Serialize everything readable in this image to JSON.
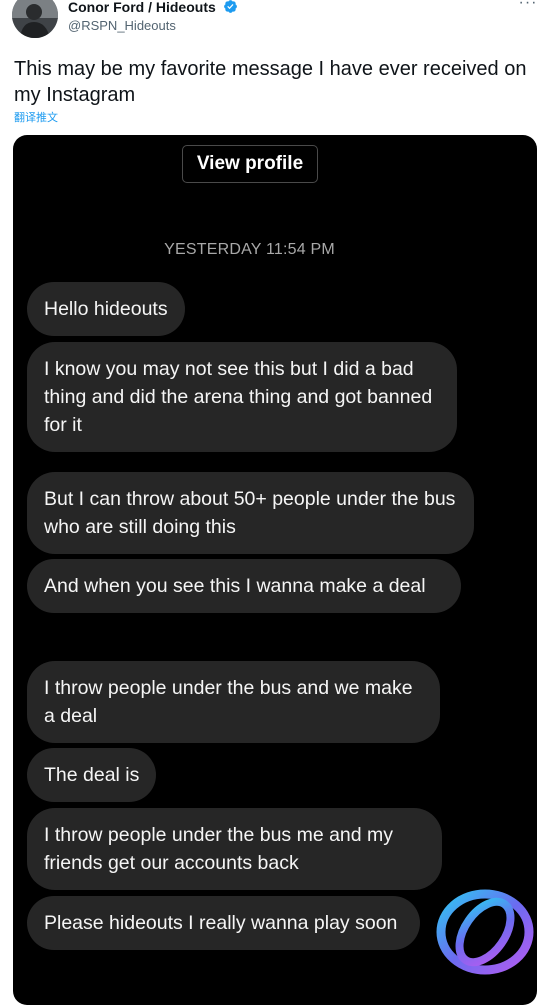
{
  "tweet": {
    "author_name": "Conor Ford / Hideouts",
    "handle": "@RSPN_Hideouts",
    "more_icon": "more-horizontal-icon",
    "text": "This may be my favorite message I have ever received on my Instagram",
    "translate_label": "翻译推文"
  },
  "dm": {
    "view_profile_label": "View profile",
    "timestamp": "YESTERDAY 11:54 PM",
    "messages": [
      "Hello hideouts",
      "I know you may not see this but I did a bad thing and did the arena thing and got banned for it",
      "But I can throw about 50+ people under the bus who are still doing this",
      "And when you see this I wanna make a deal",
      "I throw people under the bus and we make a deal",
      "The deal is",
      "I throw people under the bus me and my friends get our accounts back",
      "Please hideouts I really wanna play soon"
    ]
  },
  "colors": {
    "link": "#1d9bf0",
    "verified": "#1d9bf0",
    "bubble": "#262626",
    "media_background": "#000000"
  }
}
